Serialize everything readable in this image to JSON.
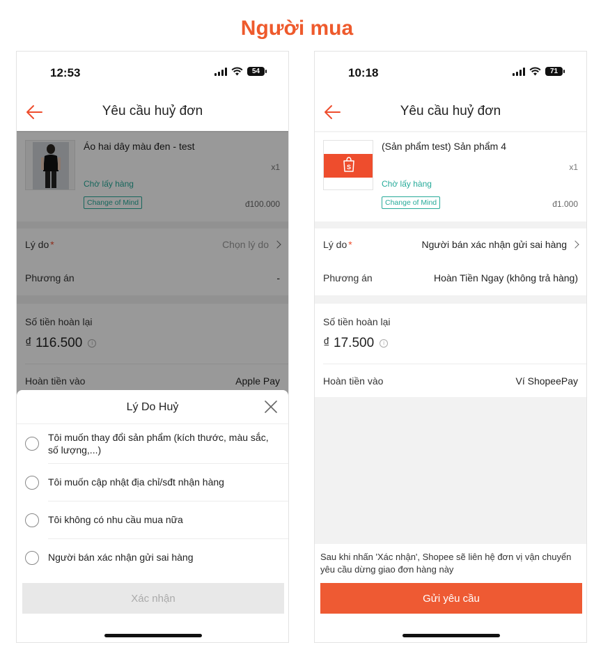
{
  "heading": "Người mua",
  "left": {
    "time": "12:53",
    "battery": "54",
    "title": "Yêu cầu huỷ đơn",
    "product": {
      "name": "Áo hai dây màu đen - test",
      "qty": "x1",
      "status": "Chờ lấy hàng",
      "badge": "Change of Mind",
      "price": "đ100.000"
    },
    "reason": {
      "label": "Lý do",
      "required": "*",
      "value": "Chọn lý do"
    },
    "solution": {
      "label": "Phương án",
      "value": "-"
    },
    "refund": {
      "label": "Số tiền hoàn lại",
      "amount": "₫ 116.500",
      "into_label": "Hoàn tiền vào",
      "into_value": "Apple Pay"
    },
    "sheet": {
      "title": "Lý Do Huỷ",
      "options": [
        "Tôi muốn thay đổi sản phẩm (kích thước, màu sắc, số lượng,...)",
        "Tôi muốn cập nhật địa chỉ/sđt nhận hàng",
        "Tôi không có nhu cầu mua nữa",
        "Người bán xác nhận gửi sai hàng"
      ],
      "confirm": "Xác nhận"
    }
  },
  "right": {
    "time": "10:18",
    "battery": "71",
    "title": "Yêu cầu huỷ đơn",
    "product": {
      "name": "(Sản phẩm test) Sản phẩm 4",
      "qty": "x1",
      "status": "Chờ lấy hàng",
      "badge": "Change of Mind",
      "price": "đ1.000"
    },
    "reason": {
      "label": "Lý do",
      "required": "*",
      "value": "Người bán xác nhận gửi sai hàng"
    },
    "solution": {
      "label": "Phương án",
      "value": "Hoàn Tiền Ngay (không trả hàng)"
    },
    "refund": {
      "label": "Số tiền hoàn lại",
      "amount": "₫ 17.500",
      "into_label": "Hoàn tiền vào",
      "into_value": "Ví ShopeePay"
    },
    "note": "Sau khi nhấn 'Xác nhận', Shopee sẽ liên hệ đơn vị vận chuyển yêu cầu dừng giao đơn hàng này",
    "submit": "Gửi yêu cầu"
  },
  "colors": {
    "accent": "#ee5a2c",
    "teal": "#26aa99"
  }
}
